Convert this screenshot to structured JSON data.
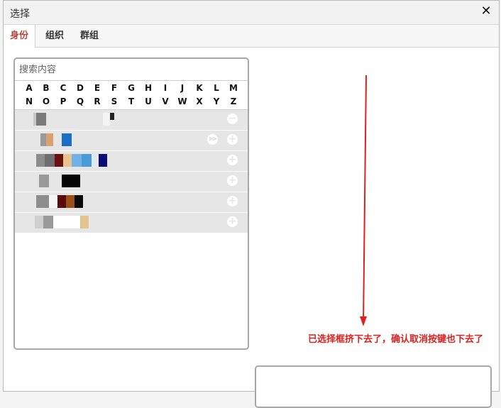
{
  "dialog": {
    "title": "选择",
    "close_glyph": "✕"
  },
  "tabs": [
    {
      "label": "身份",
      "active": true
    },
    {
      "label": "组织",
      "active": false
    },
    {
      "label": "群组",
      "active": false
    }
  ],
  "search": {
    "placeholder": "搜索内容",
    "value": ""
  },
  "alphabet": {
    "row1": [
      "A",
      "B",
      "C",
      "D",
      "E",
      "F",
      "G",
      "H",
      "I",
      "J",
      "K",
      "L",
      "M"
    ],
    "row2": [
      "N",
      "O",
      "P",
      "Q",
      "R",
      "S",
      "T",
      "U",
      "V",
      "W",
      "X",
      "Y",
      "Z"
    ]
  },
  "tree_rows": [
    {
      "name": "tree-row-root",
      "action": "collapse"
    },
    {
      "name": "tree-row-1",
      "action": "add",
      "fast_forward": true
    },
    {
      "name": "tree-row-2",
      "action": "add"
    },
    {
      "name": "tree-row-3",
      "action": "add"
    },
    {
      "name": "tree-row-4",
      "action": "add"
    },
    {
      "name": "tree-row-5",
      "action": "add"
    }
  ],
  "annotation": {
    "text": "已选择框挤下去了，确认取消按键也下去了",
    "color": "#e0201e"
  },
  "colors": {
    "active_tab": "#b3443e",
    "row_bg": "#e6e6e6",
    "border": "#a8a8a8"
  },
  "icons": {
    "close": "close-icon",
    "add": "plus-circle-icon",
    "collapse": "minus-circle-icon",
    "fast_forward": "fast-forward-icon"
  }
}
